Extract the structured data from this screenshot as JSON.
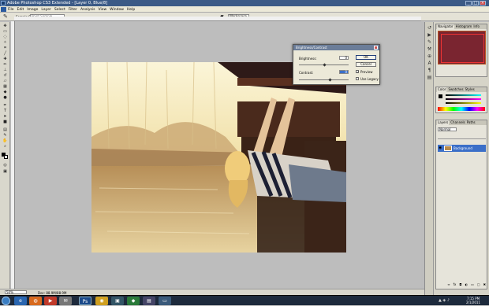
{
  "window": {
    "title": "Adobe Photoshop CS3 Extended - [Layer 0, Blue/8]"
  },
  "menubar": {
    "items": [
      "File",
      "Edit",
      "Image",
      "Layer",
      "Select",
      "Filter",
      "Analysis",
      "View",
      "Window",
      "Help"
    ]
  },
  "options_bar": {
    "sample_label": "Sample Size:",
    "sample_value": "Point Sample",
    "workspace_label": "Workspace ▾"
  },
  "dialog": {
    "title": "Brightness/Contrast",
    "brightness_label": "Brightness:",
    "brightness_value": "0",
    "contrast_label": "Contrast:",
    "contrast_value": "0",
    "ok_label": "OK",
    "cancel_label": "Cancel",
    "preview_label": "Preview",
    "preview_checked": "✓",
    "legacy_label": "Use Legacy"
  },
  "panels": {
    "navigator_tabs": [
      "Navigator",
      "Histogram",
      "Info"
    ],
    "color_tabs": [
      "Color",
      "Swatches",
      "Styles"
    ],
    "layers_tabs": [
      "Layers",
      "Channels",
      "Paths"
    ],
    "blend_mode": "Normal",
    "layer_name": "Background"
  },
  "status": {
    "zoom": "50%",
    "doc_info": "Doc: 88.9M/88.9M"
  },
  "taskbar": {
    "time": "7:15 PM",
    "date": "2/1/2011"
  },
  "colors": {
    "titlebar": "#3b5a86",
    "selection": "#3b6fc8",
    "taskbar": "#1d2a3c"
  }
}
